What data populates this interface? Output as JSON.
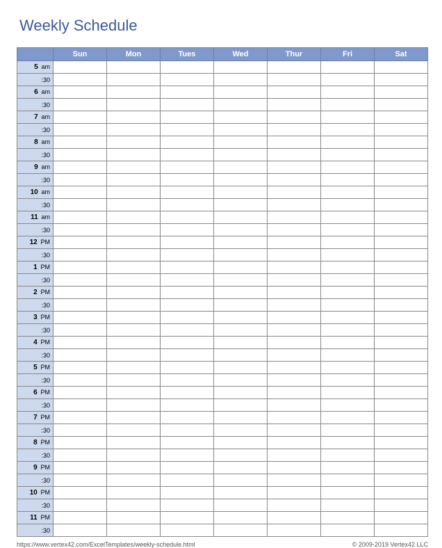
{
  "title": "Weekly Schedule",
  "days": [
    "Sun",
    "Mon",
    "Tues",
    "Wed",
    "Thur",
    "Fri",
    "Sat"
  ],
  "time_slots": [
    {
      "hour": "5",
      "ampm": "am"
    },
    {
      "hour": "6",
      "ampm": "am"
    },
    {
      "hour": "7",
      "ampm": "am"
    },
    {
      "hour": "8",
      "ampm": "am"
    },
    {
      "hour": "9",
      "ampm": "am"
    },
    {
      "hour": "10",
      "ampm": "am"
    },
    {
      "hour": "11",
      "ampm": "am"
    },
    {
      "hour": "12",
      "ampm": "PM"
    },
    {
      "hour": "1",
      "ampm": "PM"
    },
    {
      "hour": "2",
      "ampm": "PM"
    },
    {
      "hour": "3",
      "ampm": "PM"
    },
    {
      "hour": "4",
      "ampm": "PM"
    },
    {
      "hour": "5",
      "ampm": "PM"
    },
    {
      "hour": "6",
      "ampm": "PM"
    },
    {
      "hour": "7",
      "ampm": "PM"
    },
    {
      "hour": "8",
      "ampm": "PM"
    },
    {
      "hour": "9",
      "ampm": "PM"
    },
    {
      "hour": "10",
      "ampm": "PM"
    },
    {
      "hour": "11",
      "ampm": "PM"
    }
  ],
  "half_label": ":30",
  "footer": {
    "url": "https://www.vertex42.com/ExcelTemplates/weekly-schedule.html",
    "copyright": "© 2009-2019 Vertex42 LLC"
  }
}
